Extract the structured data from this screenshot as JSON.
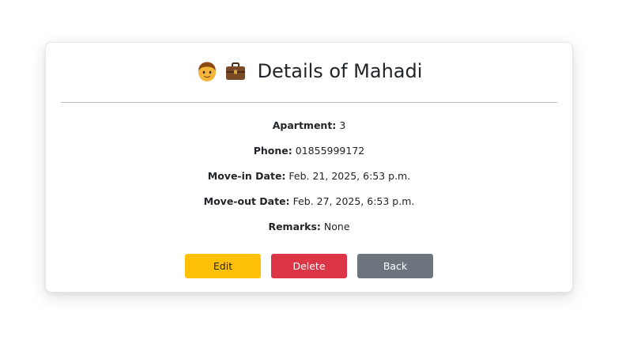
{
  "header": {
    "icons": [
      "boy-face-icon",
      "briefcase-icon"
    ],
    "title": "Details of Mahadi"
  },
  "details": [
    {
      "label": "Apartment:",
      "value": "3"
    },
    {
      "label": "Phone:",
      "value": "01855999172"
    },
    {
      "label": "Move-in Date:",
      "value": "Feb. 21, 2025, 6:53 p.m."
    },
    {
      "label": "Move-out Date:",
      "value": "Feb. 27, 2025, 6:53 p.m."
    },
    {
      "label": "Remarks:",
      "value": "None"
    }
  ],
  "actions": {
    "edit_label": "Edit",
    "delete_label": "Delete",
    "back_label": "Back"
  },
  "colors": {
    "edit": "#ffc107",
    "delete": "#dc3545",
    "back": "#6c757d"
  }
}
